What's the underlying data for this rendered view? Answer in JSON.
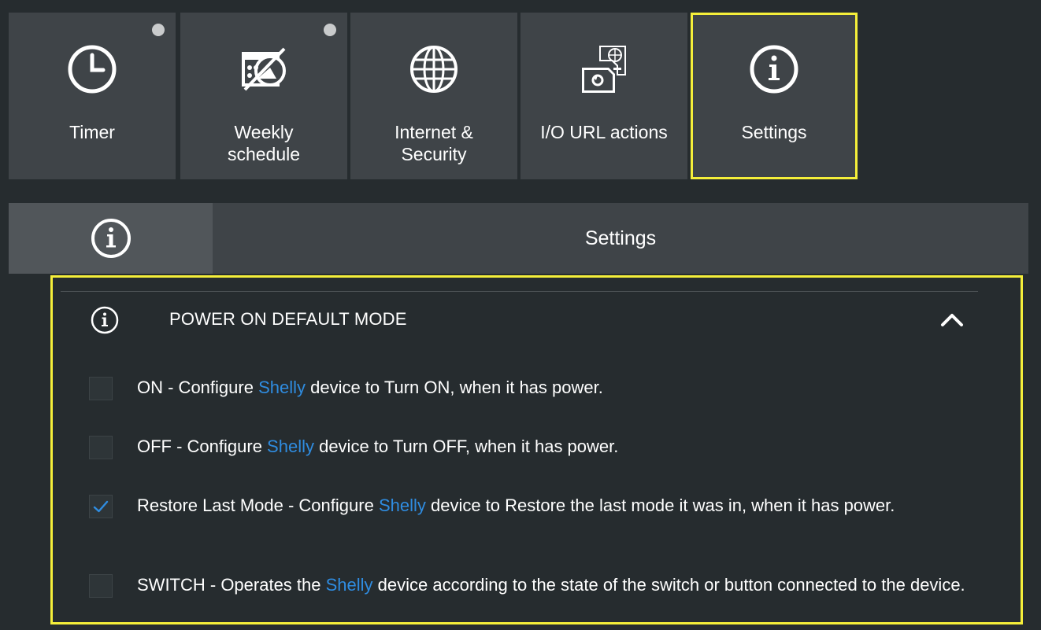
{
  "tiles": [
    {
      "label_line1": "Timer",
      "label_line2": "",
      "icon": "clock-icon",
      "has_dot": true,
      "active": false
    },
    {
      "label_line1": "Weekly",
      "label_line2": "schedule",
      "icon": "schedule-disabled-icon",
      "has_dot": true,
      "active": false
    },
    {
      "label_line1": "Internet &",
      "label_line2": "Security",
      "icon": "globe-icon",
      "has_dot": false,
      "active": false
    },
    {
      "label_line1": "I/O URL actions",
      "label_line2": "",
      "icon": "url-actions-icon",
      "has_dot": false,
      "active": false
    },
    {
      "label_line1": "Settings",
      "label_line2": "",
      "icon": "info-icon",
      "has_dot": false,
      "active": true
    }
  ],
  "header": {
    "title": "Settings",
    "icon": "info-icon"
  },
  "section": {
    "title": "POWER ON DEFAULT MODE",
    "icon": "info-icon",
    "toggle_icon": "chevron-up-icon",
    "expanded": true
  },
  "options": [
    {
      "prefix": "ON - Configure ",
      "brand": "Shelly",
      "suffix": " device to Turn ON, when it has power.",
      "checked": false
    },
    {
      "prefix": "OFF - Configure ",
      "brand": "Shelly",
      "suffix": " device to Turn OFF, when it has power.",
      "checked": false
    },
    {
      "prefix": "Restore Last Mode - Configure ",
      "brand": "Shelly",
      "suffix": " device to Restore the last mode it was in, when it has power.",
      "checked": true
    },
    {
      "prefix": "SWITCH - Operates the ",
      "brand": "Shelly",
      "suffix": " device according to the state of the switch or button connected to the device.",
      "checked": false
    }
  ],
  "colors": {
    "accent_highlight": "#f5ef3a",
    "brand_link": "#2f8ce0",
    "check": "#2f8ce0",
    "background": "#262c2f",
    "tile": "#3f4448"
  }
}
